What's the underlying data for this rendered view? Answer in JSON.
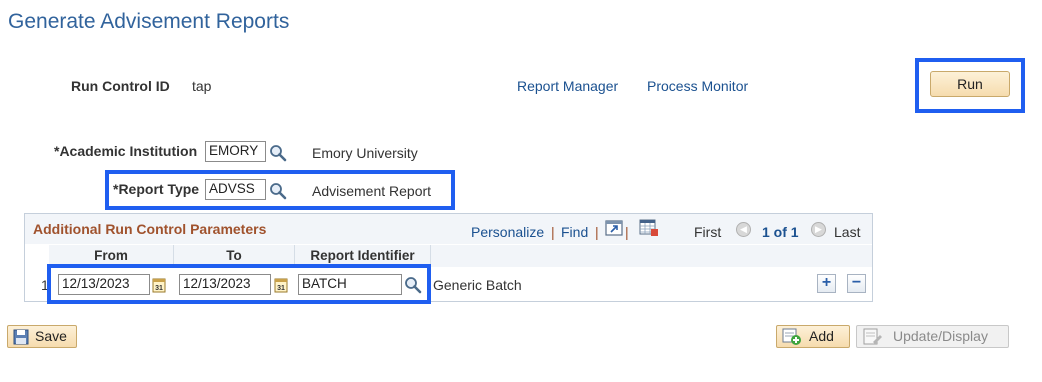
{
  "page": {
    "title": "Generate Advisement Reports"
  },
  "run_control": {
    "label": "Run Control ID",
    "value": "tap",
    "report_manager": "Report Manager",
    "process_monitor": "Process Monitor",
    "run_button": "Run"
  },
  "fields": {
    "institution_label": "*Academic Institution",
    "institution_value": "EMORY",
    "institution_desc": "Emory University",
    "report_type_label": "*Report Type",
    "report_type_value": "ADVSS",
    "report_type_desc": "Advisement Report"
  },
  "grid": {
    "title": "Additional Run Control Parameters",
    "personalize": "Personalize",
    "find": "Find",
    "sep1": "|",
    "sep2": "|",
    "sep3": "|",
    "first": "First",
    "pager": "1 of 1",
    "last": "Last",
    "columns": [
      "From",
      "To",
      "Report Identifier"
    ],
    "rows": [
      {
        "num": "1",
        "from": "12/13/2023",
        "to": "12/13/2023",
        "report_id": "BATCH",
        "desc": "Generic Batch"
      }
    ]
  },
  "footer": {
    "save": "Save",
    "add": "Add",
    "update_display": "Update/Display"
  },
  "colors": {
    "highlight": "#1f5ef0",
    "title": "#31639c",
    "grid_title": "#a0522d",
    "link": "#1b5190"
  }
}
